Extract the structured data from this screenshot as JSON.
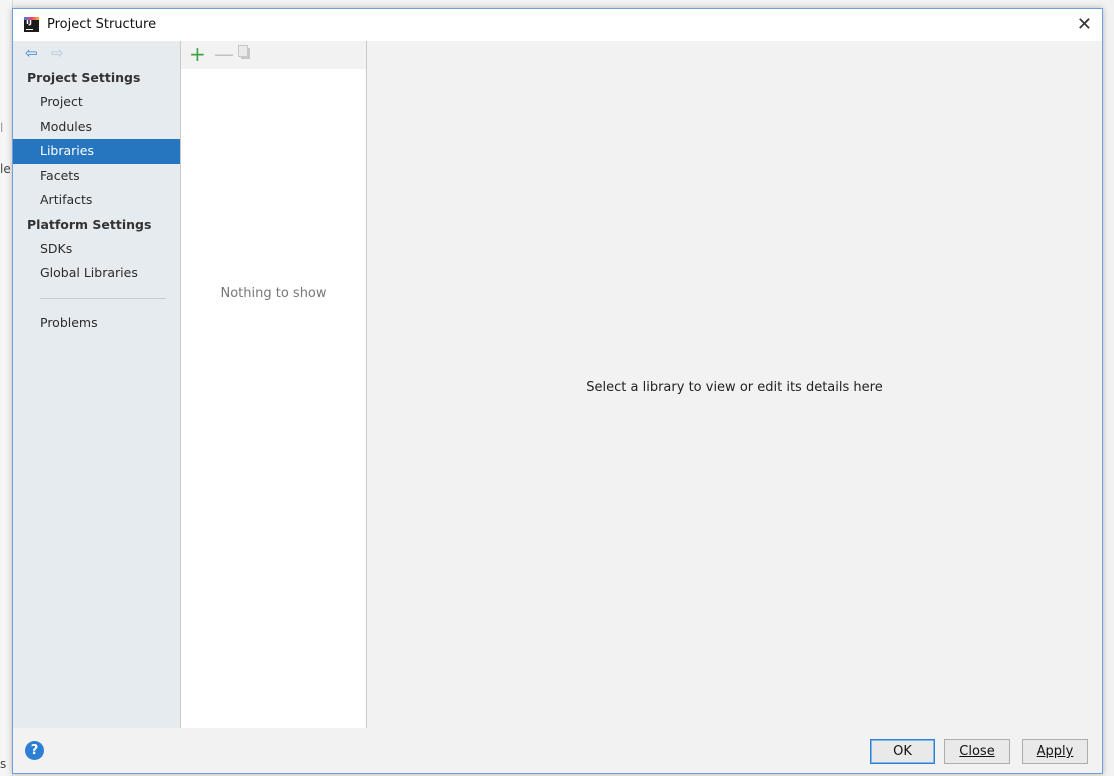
{
  "background_fragments": [
    "l",
    "le",
    "s"
  ],
  "window": {
    "logo_text": "IJ",
    "title": "Project Structure",
    "close_glyph": "✕"
  },
  "nav": {
    "back_icon": "⇦",
    "forward_icon": "⇨"
  },
  "sidebar": {
    "project_settings_header": "Project Settings",
    "project_items": [
      {
        "label": "Project"
      },
      {
        "label": "Modules"
      },
      {
        "label": "Libraries",
        "selected": true
      },
      {
        "label": "Facets"
      },
      {
        "label": "Artifacts"
      }
    ],
    "platform_settings_header": "Platform Settings",
    "platform_items": [
      {
        "label": "SDKs"
      },
      {
        "label": "Global Libraries"
      }
    ],
    "problems_label": "Problems"
  },
  "toolbar": {
    "add_icon": "+",
    "remove_icon": "—"
  },
  "library_list": {
    "empty_text": "Nothing to show"
  },
  "details": {
    "placeholder": "Select a library to view or edit its details here"
  },
  "footer": {
    "help_glyph": "?",
    "ok_label": "OK",
    "close_label": "Close",
    "apply_label": "Apply"
  },
  "colors": {
    "selection": "#2675bf",
    "add_green": "#3fa345",
    "help_blue": "#2c7fd2"
  }
}
